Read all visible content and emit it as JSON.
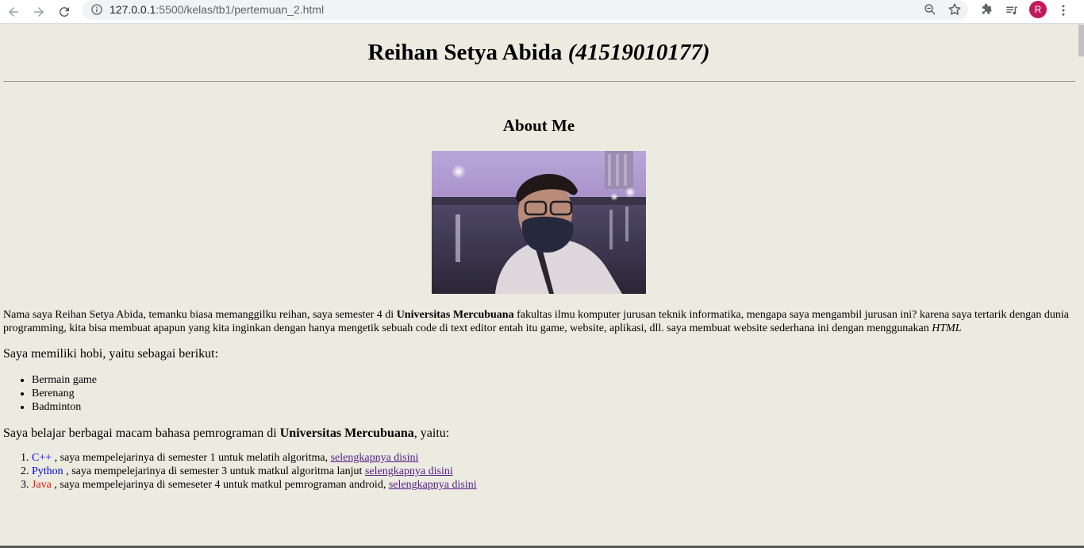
{
  "browser": {
    "url_host": "127.0.0.1",
    "url_rest": ":5500/kelas/tb1/pertemuan_2.html",
    "profile_initial": "R"
  },
  "header": {
    "name": "Reihan Setya Abida",
    "nim": "(41519010177)"
  },
  "about": {
    "heading": "About Me",
    "para_prefix": "Nama saya Reihan Setya Abida, temanku biasa memanggilku reihan, saya semester 4 di ",
    "university": "Universitas Mercubuana",
    "para_middle": " fakultas ilmu komputer jurusan teknik informatika, mengapa saya mengambil jurusan ini? karena saya tertarik dengan dunia programming, kita bisa membuat apapun yang kita inginkan dengan hanya mengetik sebuah code di text editor entah itu game, website, aplikasi, dll. saya membuat website sederhana ini dengan menggunakan ",
    "para_html": "HTML"
  },
  "hobbies": {
    "intro": "Saya memiliki hobi, yaitu sebagai berikut:",
    "items": [
      "Bermain game",
      "Berenang",
      "Badminton"
    ]
  },
  "languages": {
    "intro_prefix": "Saya belajar berbagai macam bahasa pemrograman di ",
    "intro_university": "Universitas Mercubuana",
    "intro_suffix": ", yaitu:",
    "items": [
      {
        "name": "C++",
        "color": "#0000ee",
        "desc": " , saya mempelejarinya di semester 1 untuk melatih algoritma, ",
        "link": "selengkapnya disini"
      },
      {
        "name": "Python",
        "color": "#0000ee",
        "desc": " , saya mempelejarinya di semester 3 untuk matkul algoritma lanjut ",
        "link": "selengkapnya disini"
      },
      {
        "name": "Java",
        "color": "#e8180c",
        "desc": " , saya mempelejarinya di semeseter 4 untuk matkul pemrograman android, ",
        "link": "selengkapnya disini"
      }
    ]
  }
}
